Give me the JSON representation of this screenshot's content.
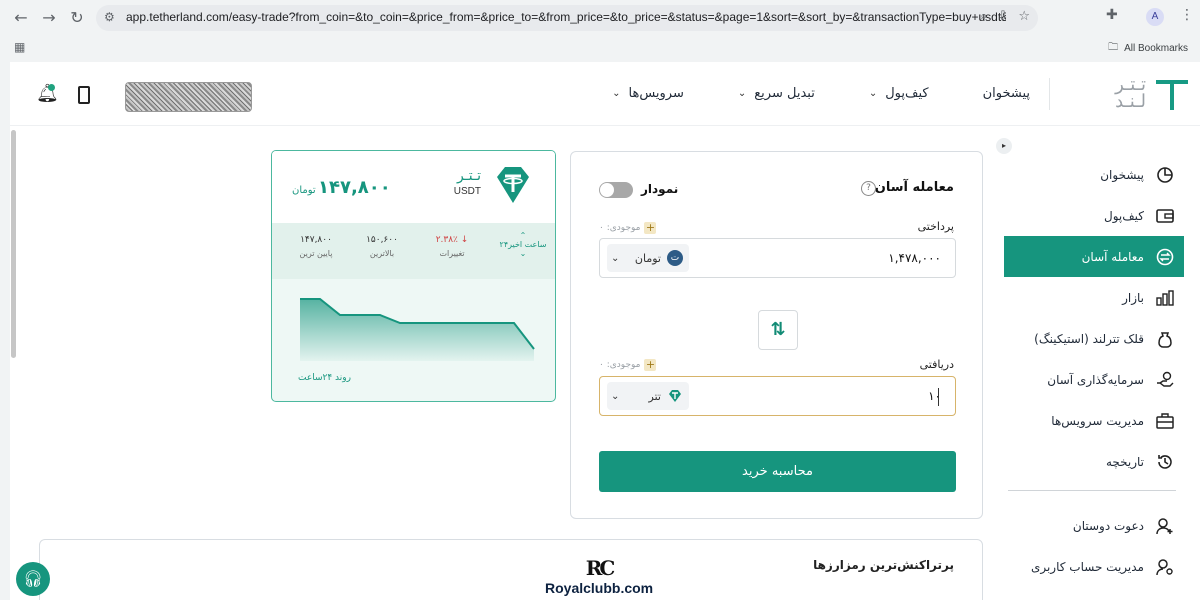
{
  "browser": {
    "url": "app.tetherland.com/easy-trade?from_coin=&to_coin=&price_from=&price_to=&from_price=&to_price=&status=&page=1&sort=&sort_by=&transactionType=buy+usdt&from=to...",
    "profile_initial": "A",
    "all_bookmarks": "All Bookmarks"
  },
  "header": {
    "logo_line1": "تـتـر",
    "logo_line2": "لـنـد",
    "nav": [
      {
        "label": "پیشخوان",
        "has_chevron": false
      },
      {
        "label": "کیف‌پول",
        "has_chevron": true
      },
      {
        "label": "تبدیل سریع",
        "has_chevron": true
      },
      {
        "label": "سرویس‌ها",
        "has_chevron": true
      }
    ]
  },
  "sidebar": {
    "items": [
      {
        "label": "پیشخوان",
        "icon": "dashboard-icon"
      },
      {
        "label": "کیف‌پول",
        "icon": "wallet-icon"
      },
      {
        "label": "معامله آسان",
        "icon": "exchange-icon",
        "active": true
      },
      {
        "label": "بازار",
        "icon": "bar-chart-icon"
      },
      {
        "label": "قلک تترلند (استیکینگ)",
        "icon": "piggy-icon"
      },
      {
        "label": "سرمایه‌گذاری آسان",
        "icon": "invest-icon"
      },
      {
        "label": "مدیریت سرویس‌ها",
        "icon": "briefcase-icon"
      },
      {
        "label": "تاریخچه",
        "icon": "history-icon"
      }
    ],
    "bottom_items": [
      {
        "label": "دعوت دوستان",
        "icon": "user-plus-icon"
      },
      {
        "label": "مدیریت حساب کاربری",
        "icon": "user-settings-icon"
      }
    ],
    "active_color": "#16957e"
  },
  "trade": {
    "title": "معامله آسان",
    "chart_toggle_label": "نمودار",
    "pay": {
      "label": "پرداختی",
      "balance_label": "موجودی: ۰",
      "amount": "۱,۴۷۸,۰۰۰",
      "currency": "تومان"
    },
    "receive": {
      "label": "دریافتی",
      "balance_label": "موجودی: ۰",
      "amount": "۱۰",
      "currency": "تتر"
    },
    "calc_button": "محاسبه خرید"
  },
  "price_card": {
    "coin_name": "تـتـر",
    "coin_symbol": "USDT",
    "price": "۱۴۷,۸۰۰",
    "unit": "تومان",
    "period": "۲۴ساعت اخیر",
    "change_value": "۲.۳۸٪",
    "change_label": "تغییرات",
    "high_value": "۱۵۰,۶۰۰",
    "high_label": "بالاترین",
    "low_value": "۱۴۷,۸۰۰",
    "low_label": "پایین ترین",
    "trend_label": "روند ۲۴ساعت",
    "accent": "#16957e"
  },
  "bottom": {
    "title": "پرتراکنش‌ترین رمزارزها",
    "watermark_logo": "RC",
    "watermark_text": "Royalclubb.com"
  }
}
